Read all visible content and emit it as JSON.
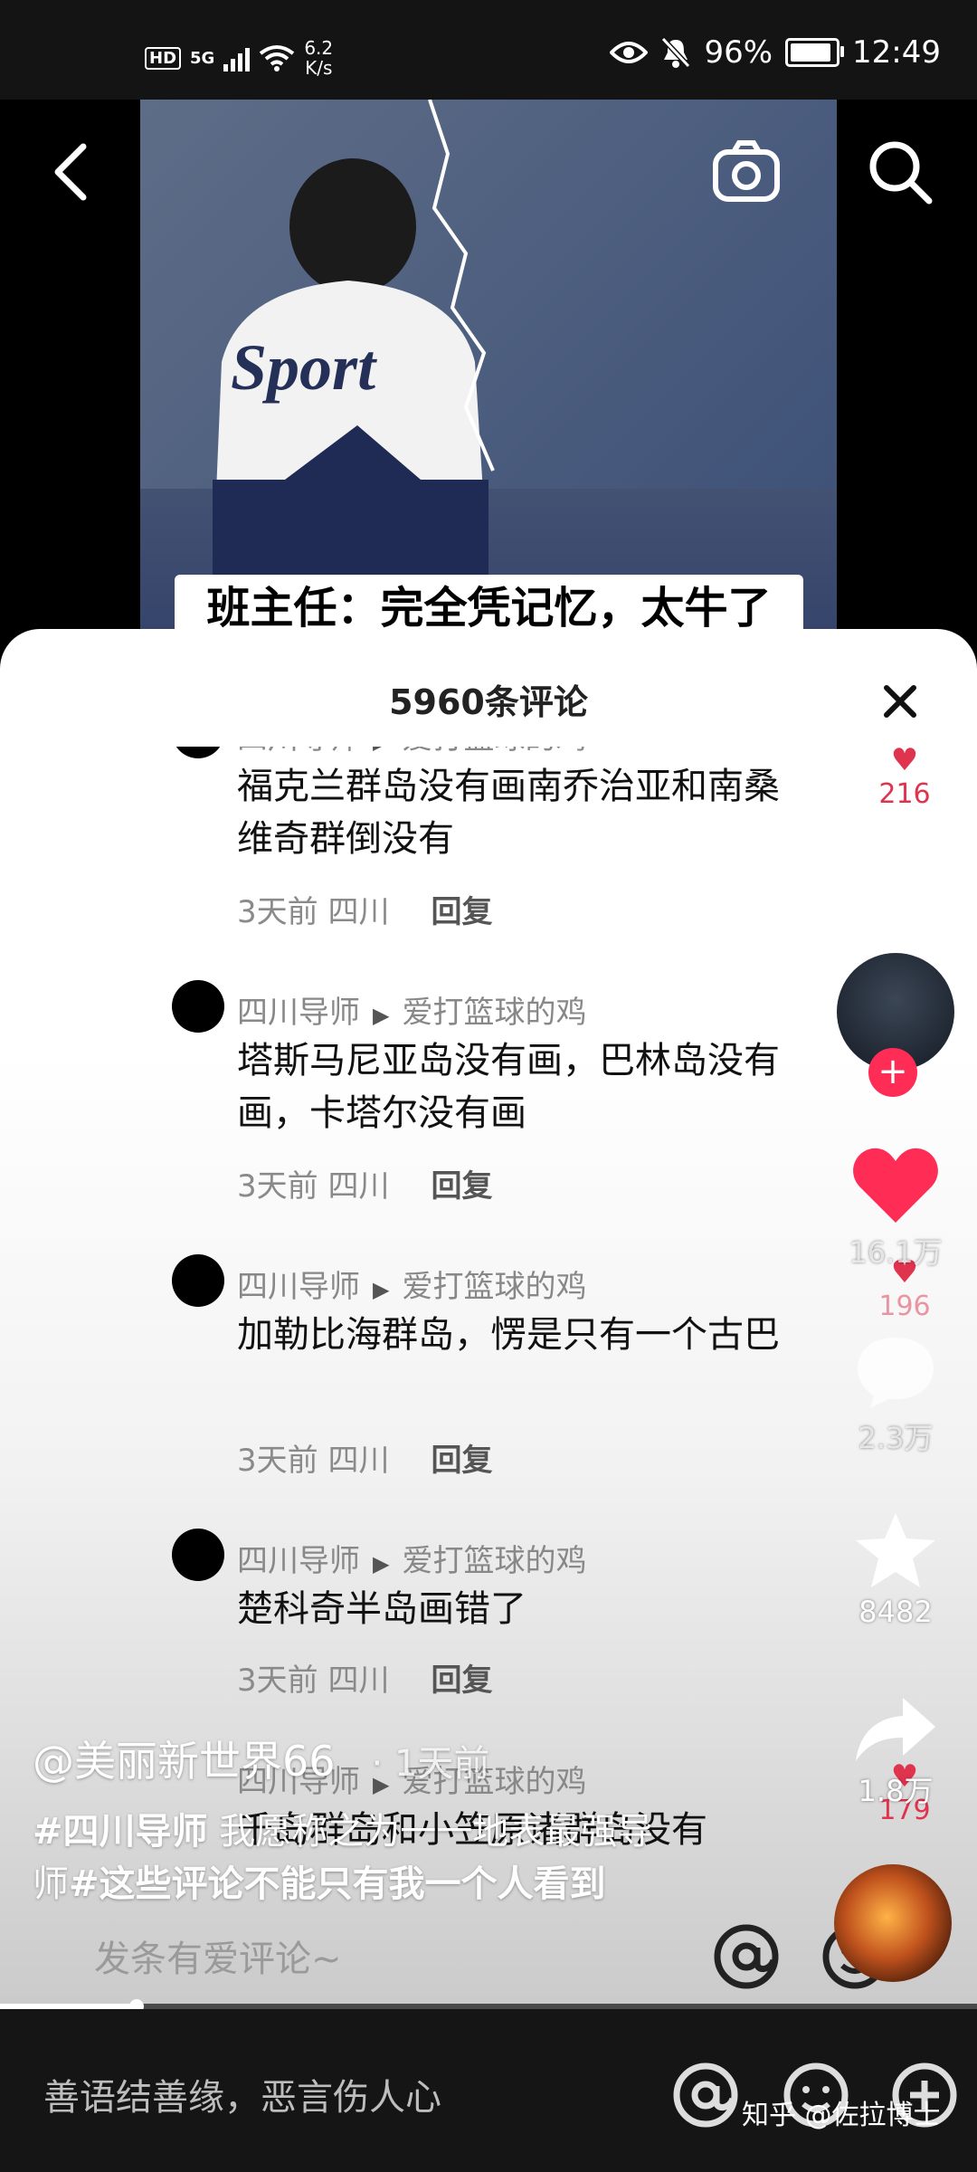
{
  "status_bar": {
    "hd": "HD",
    "network": "5G",
    "speed_value": "6.2",
    "speed_unit": "K/s",
    "battery": "96%",
    "time": "12:49"
  },
  "video": {
    "caption": "班主任：完全凭记忆，太牛了",
    "shirt_text": "Sport"
  },
  "sheet": {
    "title": "5960条评论",
    "comments": [
      {
        "user": "四川导师",
        "reply_to": "爱打篮球的鸡",
        "text": "福克兰群岛没有画南乔治亚和南桑维奇群倒没有",
        "age": "3天前",
        "location": "四川",
        "reply": "回复",
        "likes": "216"
      },
      {
        "user": "四川导师",
        "reply_to": "爱打篮球的鸡",
        "text": "塔斯马尼亚岛没有画，巴林岛没有画，卡塔尔没有画",
        "age": "3天前",
        "location": "四川",
        "reply": "回复",
        "likes": ""
      },
      {
        "user": "四川导师",
        "reply_to": "爱打篮球的鸡",
        "text": "加勒比海群岛，愣是只有一个古巴",
        "age": "3天前",
        "location": "四川",
        "reply": "回复",
        "likes": "196"
      },
      {
        "user": "四川导师",
        "reply_to": "爱打篮球的鸡",
        "text": "楚科奇半岛画错了",
        "age": "3天前",
        "location": "四川",
        "reply": "回复",
        "likes": ""
      },
      {
        "user": "四川导师",
        "reply_to": "爱打篮球的鸡",
        "text": "千岛群岛和小笠原诸群岛没有",
        "age": "",
        "location": "",
        "reply": "",
        "likes": "179"
      }
    ],
    "input_placeholder": "发条有爱评论~"
  },
  "rail": {
    "likes": "16.1万",
    "comments": "2.3万",
    "favorites": "8482",
    "shares": "1.8万"
  },
  "overlay": {
    "author": "@美丽新世界66",
    "time": "· 1天前",
    "tag1": "#四川导师",
    "desc1": " 我愿称之为一一地表最强导师",
    "tag2": "#这些评论不能只有我一个人看到"
  },
  "progress": {
    "played_fraction": 0.14
  },
  "bottom_bar": {
    "placeholder": "善语结善缘，恶言伤人心",
    "watermark": "知乎 @佐拉博士"
  },
  "colors": {
    "like": "#ff2c55",
    "sheet": "#ffffff",
    "status_bg": "#141414"
  }
}
